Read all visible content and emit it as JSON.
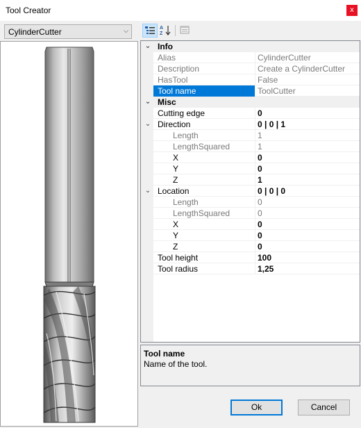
{
  "window": {
    "title": "Tool Creator",
    "close_label": "x"
  },
  "toolbar": {
    "tool_selected": "CylinderCutter"
  },
  "help": {
    "title": "Tool name",
    "description": "Name of the tool."
  },
  "buttons": {
    "ok_label": "Ok",
    "cancel_label": "Cancel"
  },
  "grid": {
    "rows": [
      {
        "kind": "category",
        "name": "Info",
        "expander": "⌄"
      },
      {
        "kind": "prop",
        "indent": 0,
        "name": "Alias",
        "value": "CylinderCutter",
        "readonly": true
      },
      {
        "kind": "prop",
        "indent": 0,
        "name": "Description",
        "value": "Create a CylinderCutter",
        "readonly": true
      },
      {
        "kind": "prop",
        "indent": 0,
        "name": "HasTool",
        "value": "False",
        "readonly": true
      },
      {
        "kind": "prop",
        "indent": 0,
        "name": "Tool name",
        "value": "ToolCutter",
        "readonly": true,
        "selected": true
      },
      {
        "kind": "category",
        "name": "Misc",
        "expander": "⌄"
      },
      {
        "kind": "prop",
        "indent": 0,
        "name": "Cutting edge",
        "value": "0",
        "bold": true
      },
      {
        "kind": "prop",
        "indent": 0,
        "name": "Direction",
        "value": "0 | 0 | 1",
        "bold": true,
        "expander": "⌄"
      },
      {
        "kind": "prop",
        "indent": 1,
        "name": "Length",
        "value": "1",
        "readonly": true
      },
      {
        "kind": "prop",
        "indent": 1,
        "name": "LengthSquared",
        "value": "1",
        "readonly": true
      },
      {
        "kind": "prop",
        "indent": 1,
        "name": "X",
        "value": "0",
        "bold": true
      },
      {
        "kind": "prop",
        "indent": 1,
        "name": "Y",
        "value": "0",
        "bold": true
      },
      {
        "kind": "prop",
        "indent": 1,
        "name": "Z",
        "value": "1",
        "bold": true
      },
      {
        "kind": "prop",
        "indent": 0,
        "name": "Location",
        "value": "0 | 0 | 0",
        "bold": true,
        "expander": "⌄"
      },
      {
        "kind": "prop",
        "indent": 1,
        "name": "Length",
        "value": "0",
        "readonly": true
      },
      {
        "kind": "prop",
        "indent": 1,
        "name": "LengthSquared",
        "value": "0",
        "readonly": true
      },
      {
        "kind": "prop",
        "indent": 1,
        "name": "X",
        "value": "0",
        "bold": true
      },
      {
        "kind": "prop",
        "indent": 1,
        "name": "Y",
        "value": "0",
        "bold": true
      },
      {
        "kind": "prop",
        "indent": 1,
        "name": "Z",
        "value": "0",
        "bold": true
      },
      {
        "kind": "prop",
        "indent": 0,
        "name": "Tool height",
        "value": "100",
        "bold": true
      },
      {
        "kind": "prop",
        "indent": 0,
        "name": "Tool radius",
        "value": "1,25",
        "bold": true
      }
    ]
  }
}
